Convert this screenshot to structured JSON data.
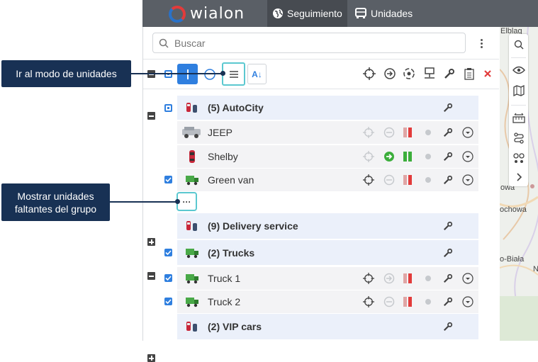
{
  "app": {
    "logo_text": "wialon",
    "brand_colors": [
      "#e23b3b",
      "#2a72c8"
    ]
  },
  "tabs": [
    {
      "label": "Seguimiento",
      "icon": "globe-icon",
      "active": true
    },
    {
      "label": "Unidades",
      "icon": "bus-icon",
      "active": false
    }
  ],
  "search": {
    "placeholder": "Buscar",
    "value": ""
  },
  "callouts": {
    "units_mode": "Ir al modo de unidades",
    "missing_units": "Mostrar unidades faltantes del grupo"
  },
  "more_button": "···",
  "rows": [
    {
      "type": "group",
      "label": "(5) AutoCity",
      "icon": "car-red-icon",
      "checkbox": "partial",
      "expander": "collapse"
    },
    {
      "type": "unit",
      "label": "JEEP",
      "icon": "jeep-icon",
      "checkbox": "none",
      "status": "inactive"
    },
    {
      "type": "unit",
      "label": "Shelby",
      "icon": "car-red-icon",
      "checkbox": "none",
      "status": "active-green"
    },
    {
      "type": "unit",
      "label": "Green van",
      "icon": "truck-green-icon",
      "checkbox": "checked",
      "status": "normal"
    },
    {
      "type": "group",
      "label": "(9) Delivery service",
      "icon": "car-red-icon",
      "checkbox": "none",
      "expander": "expand"
    },
    {
      "type": "group",
      "label": "(2) Trucks",
      "icon": "truck-green-icon",
      "checkbox": "checked",
      "expander": "collapse"
    },
    {
      "type": "unit",
      "label": "Truck 1",
      "icon": "truck-green-icon",
      "checkbox": "checked",
      "status": "normal"
    },
    {
      "type": "unit",
      "label": "Truck 2",
      "icon": "truck-green-icon",
      "checkbox": "checked",
      "status": "normal"
    },
    {
      "type": "group",
      "label": "(2) VIP cars",
      "icon": "car-red-icon",
      "checkbox": "none",
      "expander": "expand"
    }
  ],
  "map_labels": [
    "Elblag",
    "owa",
    "ochowa",
    "o-Biała",
    "N"
  ],
  "colors": {
    "accent": "#2f7fdf",
    "callout": "#183154",
    "highlight": "#5bc8d0",
    "danger": "#e23b3b",
    "ok": "#3cae3c"
  }
}
